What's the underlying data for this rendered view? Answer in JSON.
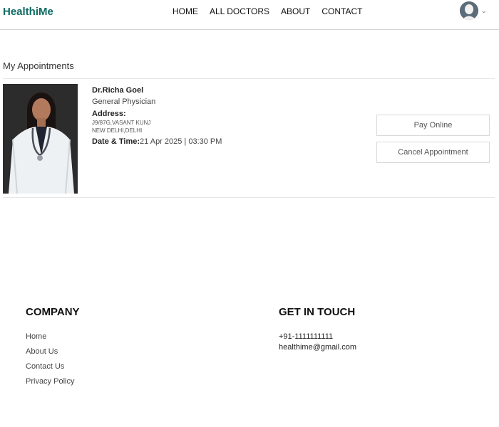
{
  "brand": {
    "name": "HealthiMe",
    "color": "#0f6b63"
  },
  "nav": {
    "links": [
      "HOME",
      "ALL DOCTORS",
      "ABOUT",
      "CONTACT"
    ]
  },
  "profile": {
    "avatar_icon": "user-avatar-icon",
    "dropdown_icon": "chevron-down-icon"
  },
  "page": {
    "title": "My Appointments"
  },
  "appointment": {
    "doctor_name": "Dr.Richa Goel",
    "speciality": "General Physician",
    "address_label": "Address:",
    "address_line1": "J9/87G,VASANT KUNJ",
    "address_line2": "NEW DELHI,DELHI",
    "datetime_label": "Date & Time:",
    "datetime_value": "21 Apr 2025 | 03:30 PM",
    "pay_label": "Pay Online",
    "cancel_label": "Cancel Appointment"
  },
  "footer": {
    "company_heading": "COMPANY",
    "company_links": [
      "Home",
      "About Us",
      "Contact Us",
      "Privacy Policy"
    ],
    "contact_heading": "GET IN TOUCH",
    "phone": "+91-1111111111",
    "email": "healthime@gmail.com"
  }
}
